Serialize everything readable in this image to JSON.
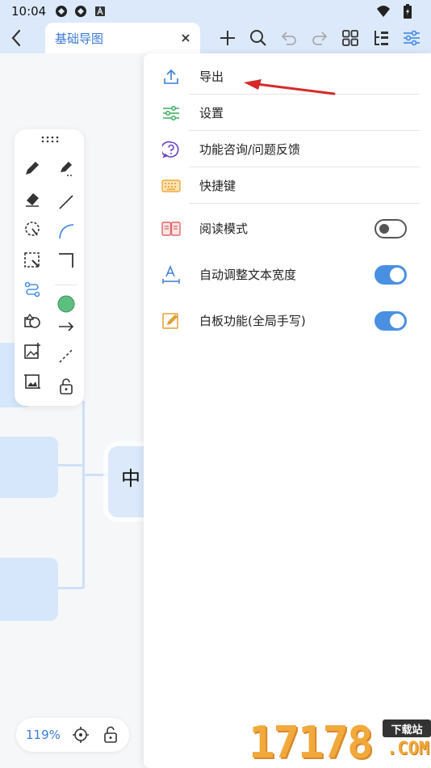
{
  "status_bar": {
    "time": "10:04",
    "left_icons": [
      "sync-icon",
      "sync-icon",
      "notification-a-icon"
    ],
    "right_icons": [
      "wifi-icon",
      "battery-icon"
    ]
  },
  "toolbar": {
    "tab_title": "基础导图",
    "tab_close": "×",
    "actions": [
      "add-icon",
      "search-icon",
      "undo-icon",
      "redo-icon",
      "layout-grid-icon",
      "outline-icon",
      "settings-sliders-icon"
    ]
  },
  "menu": {
    "items": [
      {
        "label": "导出",
        "icon": "export-upload-icon",
        "color": "#3a7bd5"
      },
      {
        "label": "设置",
        "icon": "sliders-icon",
        "color": "#3cae5b"
      },
      {
        "label": "功能咨询/问题反馈",
        "icon": "question-icon",
        "color": "#6a3fc4"
      },
      {
        "label": "快捷键",
        "icon": "keyboard-icon",
        "color": "#f2a93b"
      },
      {
        "label": "阅读模式",
        "icon": "book-icon",
        "color": "#e06666",
        "toggle": false
      },
      {
        "label": "自动调整文本宽度",
        "icon": "text-width-icon",
        "color": "#3a7bd5",
        "toggle": true
      },
      {
        "label": "白板功能(全局手写)",
        "icon": "whiteboard-pen-icon",
        "color": "#e0a030",
        "toggle": true
      }
    ]
  },
  "canvas": {
    "center_node_text": "中"
  },
  "zoom": {
    "value": "119%"
  },
  "watermark": {
    "number": "17178",
    "badge": "下载站",
    "suffix": ".COM"
  },
  "colors": {
    "accent": "#4a90e2",
    "toolbar_bg": "#dce9fb",
    "node_bg": "#d6e7fb",
    "annotation_arrow": "#d62a2a"
  }
}
